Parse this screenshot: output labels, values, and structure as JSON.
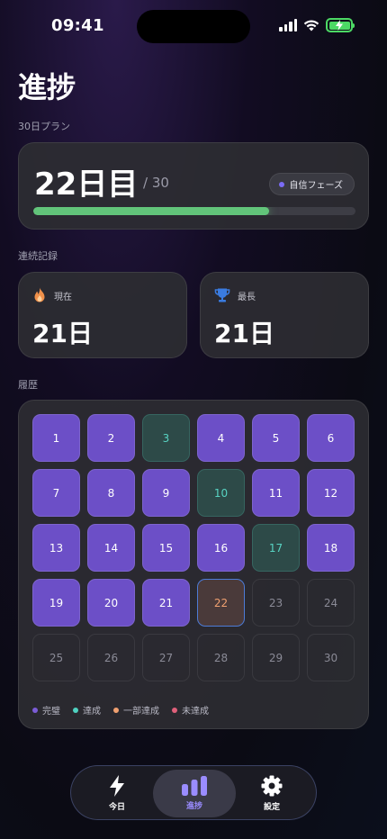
{
  "status": {
    "time": "09:41"
  },
  "header": {
    "title": "進捗"
  },
  "plan": {
    "section_label": "30日プラン",
    "current_day": "22日目",
    "total": "/ 30",
    "phase": "自信フェーズ",
    "progress_fraction": 0.733
  },
  "streak": {
    "section_label": "連続記録",
    "current_label": "現在",
    "current_value": "21日",
    "best_label": "最長",
    "best_value": "21日"
  },
  "history": {
    "section_label": "履歴",
    "days": [
      {
        "label": "1",
        "status": "complete"
      },
      {
        "label": "2",
        "status": "complete"
      },
      {
        "label": "3",
        "status": "achieved"
      },
      {
        "label": "4",
        "status": "complete"
      },
      {
        "label": "5",
        "status": "complete"
      },
      {
        "label": "6",
        "status": "complete"
      },
      {
        "label": "7",
        "status": "complete"
      },
      {
        "label": "8",
        "status": "complete"
      },
      {
        "label": "9",
        "status": "complete"
      },
      {
        "label": "10",
        "status": "achieved"
      },
      {
        "label": "11",
        "status": "complete"
      },
      {
        "label": "12",
        "status": "complete"
      },
      {
        "label": "13",
        "status": "complete"
      },
      {
        "label": "14",
        "status": "complete"
      },
      {
        "label": "15",
        "status": "complete"
      },
      {
        "label": "16",
        "status": "complete"
      },
      {
        "label": "17",
        "status": "achieved"
      },
      {
        "label": "18",
        "status": "complete"
      },
      {
        "label": "19",
        "status": "complete"
      },
      {
        "label": "20",
        "status": "complete"
      },
      {
        "label": "21",
        "status": "complete"
      },
      {
        "label": "22",
        "status": "current"
      },
      {
        "label": "23",
        "status": "future"
      },
      {
        "label": "24",
        "status": "future"
      },
      {
        "label": "25",
        "status": "future"
      },
      {
        "label": "26",
        "status": "future"
      },
      {
        "label": "27",
        "status": "future"
      },
      {
        "label": "28",
        "status": "future"
      },
      {
        "label": "29",
        "status": "future"
      },
      {
        "label": "30",
        "status": "future"
      }
    ],
    "legend": [
      {
        "label": "完璧",
        "color": "#7b5cd6"
      },
      {
        "label": "達成",
        "color": "#4fd1c0"
      },
      {
        "label": "一部達成",
        "color": "#f0a070"
      },
      {
        "label": "未達成",
        "color": "#e0607a"
      }
    ]
  },
  "tabbar": {
    "today": "今日",
    "progress": "進捗",
    "settings": "設定"
  },
  "colors": {
    "accent": "#9a8cff",
    "progress": "#62c47a",
    "complete": "#6c4fc7",
    "achieved": "#58d3c2"
  },
  "icons": {
    "today": "bolt-icon",
    "progress": "bar-chart-icon",
    "settings": "gear-icon",
    "current_streak": "flame-icon",
    "best_streak": "trophy-icon"
  }
}
